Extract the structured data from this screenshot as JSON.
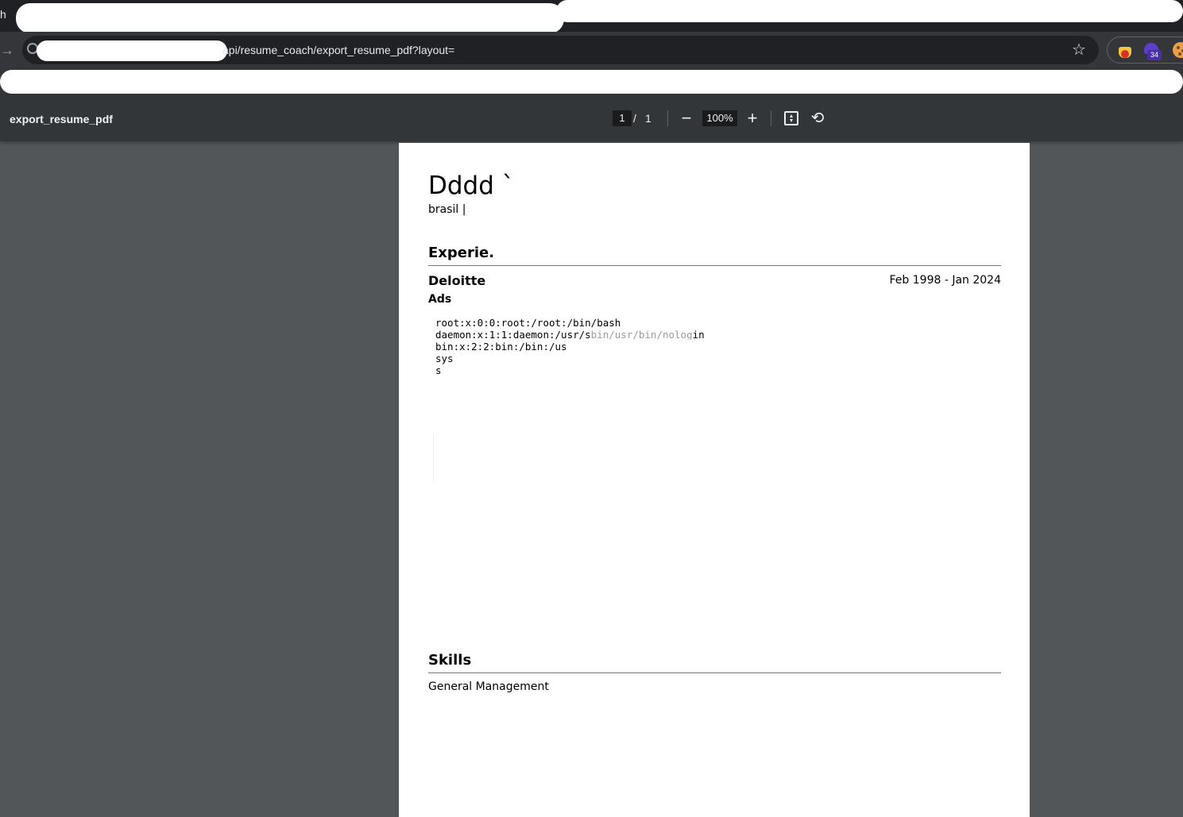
{
  "browser": {
    "tab_partial_text": "h",
    "address": "api/resume_coach/export_resume_pdf?layout=",
    "extension_badge": "34"
  },
  "pdf_viewer": {
    "title": "export_resume_pdf",
    "page_current": "1",
    "page_separator": "/",
    "page_total": "1",
    "zoom": "100%",
    "zoom_out_label": "−",
    "zoom_in_label": "+",
    "rotate_label": "⟲"
  },
  "resume": {
    "name": "Dddd `",
    "contact": "brasil | ",
    "experience_heading": "Experie.",
    "company": "Deloitte",
    "dates": "Feb 1998 - Jan 2024",
    "role": "Ads",
    "description": "root:x:0:0:root:/root:/bin/bash\ndaemon:x:1:1:daemon:/usr/sbin/usr/bin/nologin\nbin:x:2:2:bin:/bin:/us\nsys\ns",
    "skills_heading": "Skills",
    "skills": "General Management"
  }
}
